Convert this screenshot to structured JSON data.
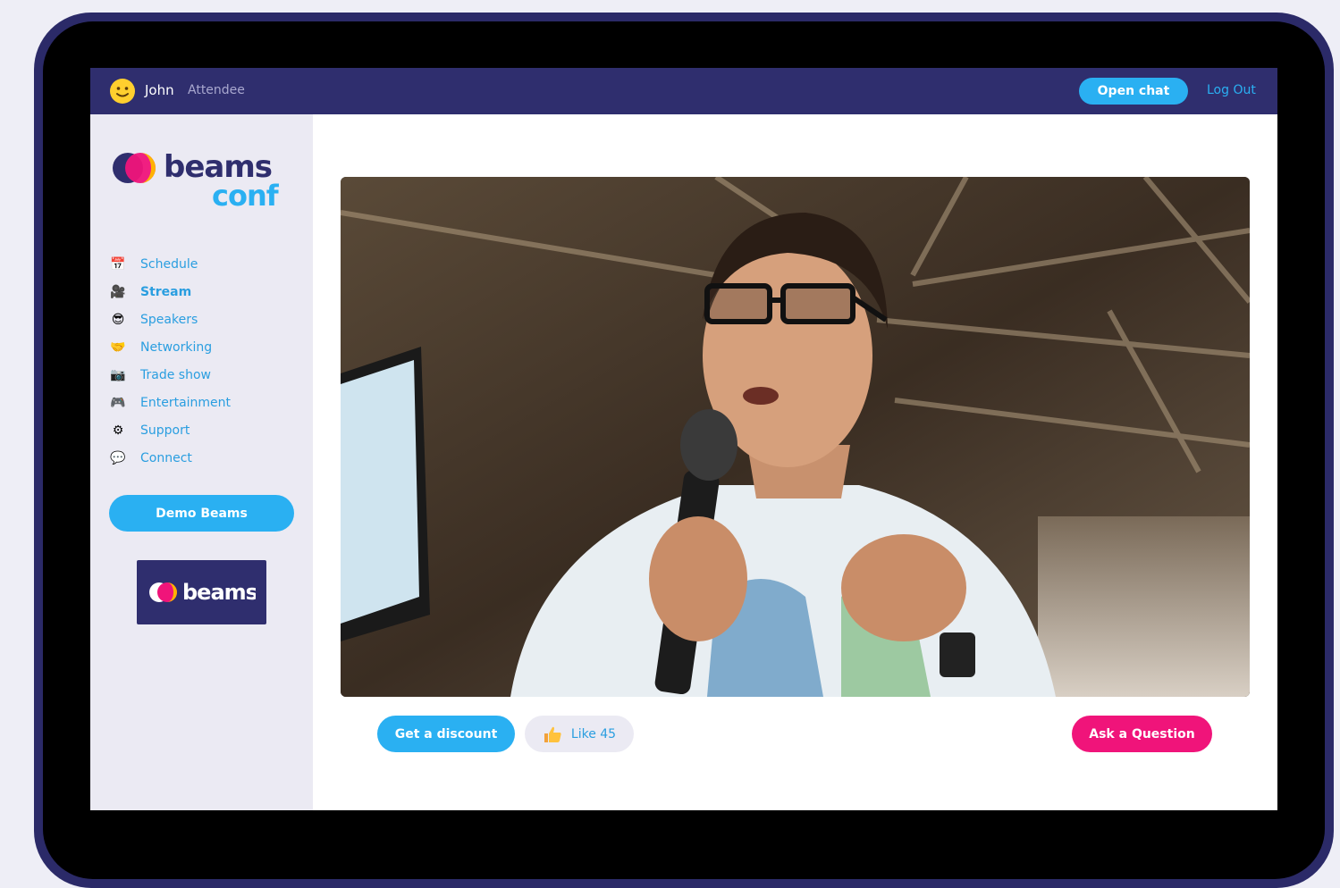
{
  "header": {
    "avatar_icon": "smiley-face-icon",
    "user_name": "John",
    "user_role": "Attendee",
    "open_chat_label": "Open chat",
    "logout_label": "Log Out"
  },
  "brand": {
    "logo_word": "beams",
    "logo_sub": "conf"
  },
  "sidebar": {
    "items": [
      {
        "label": "Schedule",
        "icon": "calendar-icon",
        "glyph": "📅",
        "active": false
      },
      {
        "label": "Stream",
        "icon": "movie-camera-icon",
        "glyph": "🎥",
        "active": true
      },
      {
        "label": "Speakers",
        "icon": "sunglasses-face-icon",
        "glyph": "😎",
        "active": false
      },
      {
        "label": "Networking",
        "icon": "handshake-icon",
        "glyph": "🤝",
        "active": false
      },
      {
        "label": "Trade show",
        "icon": "camera-icon",
        "glyph": "📷",
        "active": false
      },
      {
        "label": "Entertainment",
        "icon": "gamepad-icon",
        "glyph": "🎮",
        "active": false
      },
      {
        "label": "Support",
        "icon": "gear-icon",
        "glyph": "⚙",
        "active": false
      },
      {
        "label": "Connect",
        "icon": "speech-bubble-icon",
        "glyph": "💬",
        "active": false
      }
    ],
    "demo_button_label": "Demo Beams",
    "sponsor_logo_word": "beams"
  },
  "main": {
    "discount_label": "Get a discount",
    "like_label": "Like 45",
    "like_icon": "thumbs-up-icon",
    "ask_label": "Ask a Question"
  },
  "colors": {
    "navy": "#2f2e6e",
    "accent_blue": "#2ab0f2",
    "link_blue": "#2a9ee0",
    "pink": "#f0147a",
    "sidebar_bg": "#ebeaf3"
  }
}
